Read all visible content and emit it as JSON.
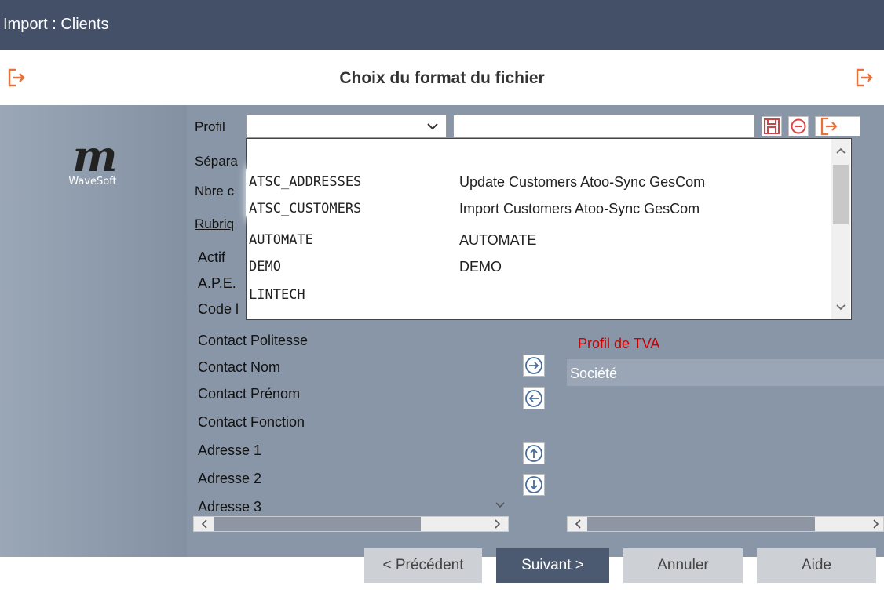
{
  "window": {
    "title": "Import : Clients"
  },
  "header": {
    "title": "Choix du format du fichier"
  },
  "logo": {
    "brand": "WaveSoft"
  },
  "form": {
    "profil_label": "Profil",
    "separateur_label": "Sépara",
    "nbre_label": "Nbre c",
    "rubriques_label": "Rubriq",
    "profil_value": "",
    "profil_name_value": ""
  },
  "dropdown": {
    "items": [
      {
        "code": "ATSC_ADDRESSES",
        "desc": "Update Customers Atoo-Sync GesCom"
      },
      {
        "code": "ATSC_CUSTOMERS",
        "desc": "Import Customers Atoo-Sync GesCom"
      },
      {
        "code": "AUTOMATE",
        "desc": "AUTOMATE"
      },
      {
        "code": "DEMO",
        "desc": "DEMO"
      },
      {
        "code": "LINTECH",
        "desc": ""
      }
    ]
  },
  "rubriques": {
    "items": [
      "Actif",
      "A.P.E.",
      "Code l",
      "Contact Politesse",
      "Contact Nom",
      "Contact Prénom",
      "Contact Fonction",
      "Adresse 1",
      "Adresse 2",
      "Adresse 3"
    ]
  },
  "right": {
    "label": "Profil de TVA",
    "selected": "Société"
  },
  "footer": {
    "prev": "< Précédent",
    "next": "Suivant >",
    "cancel": "Annuler",
    "help": "Aide"
  },
  "colors": {
    "accent": "#e8703a",
    "title_bg": "#445068",
    "panel_bg": "#8896a7",
    "red_label": "#cc0000"
  },
  "icons": {
    "header_left": "exit-icon",
    "header_right": "exit-icon",
    "toolbar": [
      "save-icon",
      "remove-icon",
      "exit-icon"
    ],
    "arrows": [
      "arrow-right-icon",
      "arrow-left-icon",
      "arrow-up-icon",
      "arrow-down-icon"
    ]
  }
}
